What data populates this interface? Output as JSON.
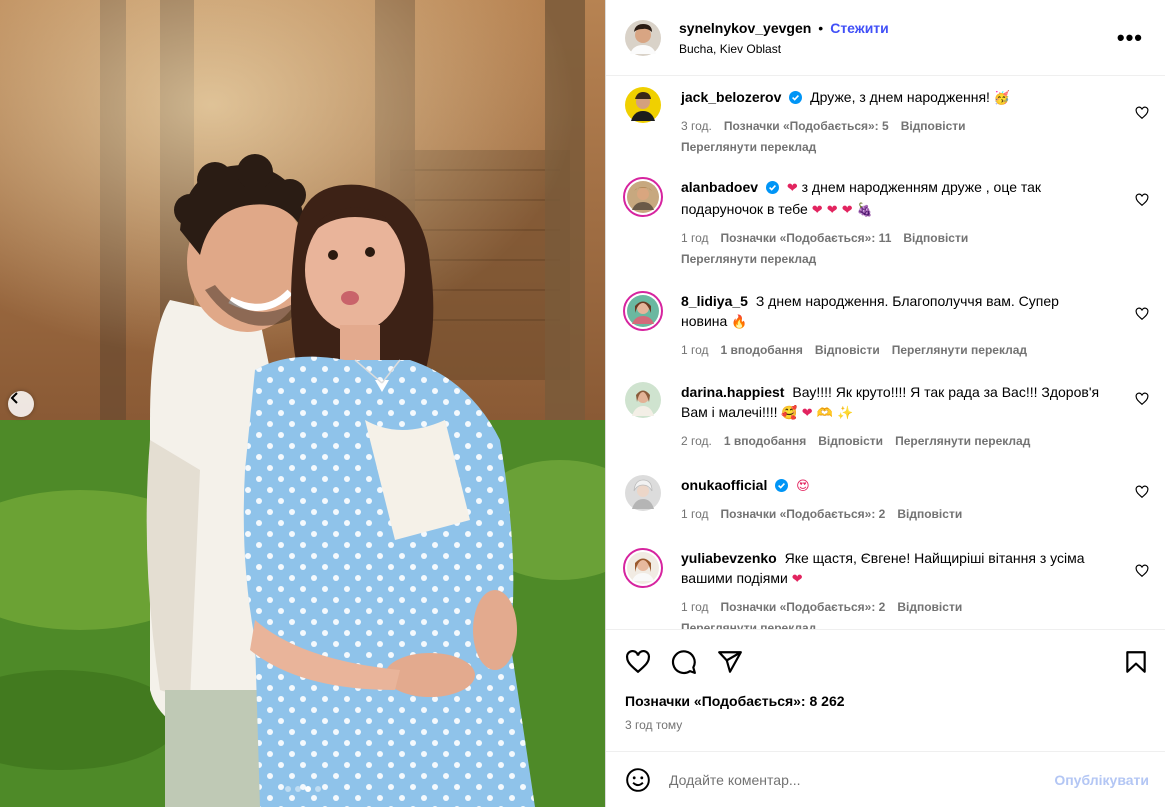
{
  "header": {
    "username": "synelnykov_yevgen",
    "separator": "•",
    "follow_label": "Стежити",
    "location": "Bucha, Kiev Oblast",
    "more_label": "•••"
  },
  "media": {
    "slide_count": 4,
    "active_slide": 3,
    "prev_icon": "chevron-left-icon"
  },
  "comments": [
    {
      "username": "jack_belozerov",
      "verified": true,
      "text": "Друже, з днем народження!",
      "emoji": "🥳",
      "time": "3 год.",
      "likes": "Позначки «Подобається»: 5",
      "reply": "Відповісти",
      "translate": "Переглянути переклад"
    },
    {
      "username": "alanbadoev",
      "verified": true,
      "text_prefix_emoji": "❤",
      "text": "з днем народженням друже , оце так подаруночок в тебе",
      "emoji": "❤ ❤ ❤ 🍇",
      "time": "1 год",
      "likes": "Позначки «Подобається»: 11",
      "reply": "Відповісти",
      "translate": "Переглянути переклад"
    },
    {
      "username": "8_lidiya_5",
      "verified": false,
      "text": "З днем народження. Благополуччя вам. Супер новина",
      "emoji": "🔥",
      "time": "1 год",
      "likes": "1 вподобання",
      "reply": "Відповісти",
      "translate": "Переглянути переклад"
    },
    {
      "username": "darina.happiest",
      "verified": false,
      "text": "Вау!!!! Як круто!!!! Я так рада за Вас!!! Здоров'я Вам і малечі!!!!",
      "emoji": "🥰 ❤ 🫶 ✨",
      "time": "2 год.",
      "likes": "1 вподобання",
      "reply": "Відповісти",
      "translate": "Переглянути переклад"
    },
    {
      "username": "onukaofficial",
      "verified": true,
      "text": "",
      "emoji": "😍",
      "time": "1 год",
      "likes": "Позначки «Подобається»: 2",
      "reply": "Відповісти",
      "translate": ""
    },
    {
      "username": "yuliabevzenko",
      "verified": false,
      "text": "Яке щастя, Євгене! Найщиріші вітання з усіма вашими подіями",
      "emoji": "❤",
      "time": "1 год",
      "likes": "Позначки «Подобається»: 2",
      "reply": "Відповісти",
      "translate": "Переглянути переклад"
    }
  ],
  "footer": {
    "likes": "Позначки «Подобається»: 8 262",
    "posted": "3 год тому",
    "comment_placeholder": "Додайте коментар...",
    "publish_label": "Опублікувати"
  },
  "colors": {
    "accent": "#4150f7",
    "muted": "#737373",
    "verified": "#0095f6",
    "publish_disabled": "#b3c6f4",
    "dress": "#8fc3ea",
    "shirt": "#f4f1ea"
  }
}
